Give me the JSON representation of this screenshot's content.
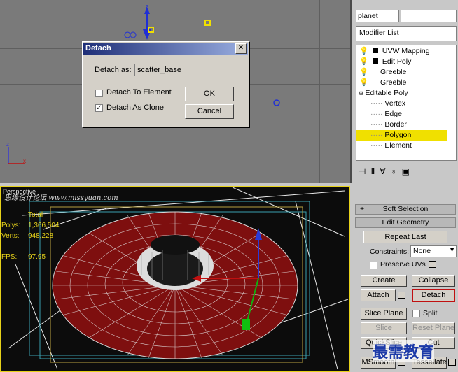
{
  "top_viewport": {
    "axis_z": "z",
    "axis_y": "y",
    "axis_x": "x"
  },
  "dialog": {
    "title": "Detach",
    "detach_as_label": "Detach as:",
    "detach_as_value": "scatter_base",
    "option1": "Detach To Element",
    "option2": "Detach As Clone",
    "option2_checked": true,
    "ok": "OK",
    "cancel": "Cancel"
  },
  "perspective_viewport": {
    "label": "Perspective",
    "stats_total": "Total",
    "polys_label": "Polys:",
    "polys_value": "1,366,504",
    "verts_label": "Verts:",
    "verts_value": "948,228",
    "fps_label": "FPS:",
    "fps_value": "97.95"
  },
  "right_panel": {
    "object_name": "planet",
    "modifier_list": "Modifier List",
    "stack": [
      {
        "label": "UVW Mapping",
        "icons": true
      },
      {
        "label": "Edit Poly",
        "icons": true
      },
      {
        "label": "Greeble",
        "icons": false
      },
      {
        "label": "Greeble",
        "icons": false
      },
      {
        "label": "Editable Poly",
        "icons": false
      },
      {
        "label": "Vertex"
      },
      {
        "label": "Edge"
      },
      {
        "label": "Border"
      },
      {
        "label": "Polygon",
        "selected": true
      },
      {
        "label": "Element"
      }
    ],
    "soft_selection": "Soft Selection",
    "edit_geometry": "Edit Geometry",
    "repeat_last": "Repeat Last",
    "constraints_label": "Constraints:",
    "constraints_value": "None",
    "preserve_uvs": "Preserve UVs",
    "create": "Create",
    "collapse": "Collapse",
    "attach": "Attach",
    "detach": "Detach",
    "slice_plane": "Slice Plane",
    "split": "Split",
    "slice": "Slice",
    "reset_plane": "Reset Plane",
    "quickslice": "QuickSlice",
    "cut": "Cut",
    "msmooth": "MSmooth",
    "tessellate": "Tessellate"
  },
  "watermark_top": "思缘设计论坛 www.missyuan.com",
  "watermark_bottom": "最需教育",
  "colors": {
    "selected_row": "#f0e000",
    "viewport_border": "#e7d21a",
    "mesh": "#9b1212"
  }
}
